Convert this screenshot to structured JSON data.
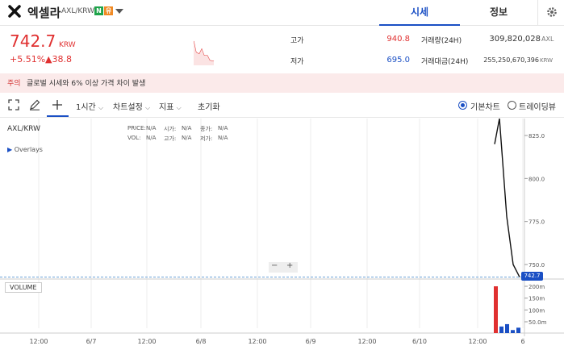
{
  "header": {
    "coin_name": "엑셀라",
    "pair": "AXL/KRW",
    "badge_n": "N",
    "badge_w": "유",
    "tabs": [
      "시세",
      "정보"
    ]
  },
  "price": {
    "value": "742.7",
    "unit": "KRW",
    "change_pct": "+5.51%",
    "change_amt": "▲38.8"
  },
  "stats": {
    "high_label": "고가",
    "high_value": "940.8",
    "low_label": "저가",
    "low_value": "695.0",
    "volume_label": "거래량(24H)",
    "volume_value": "309,820,028",
    "volume_unit": "AXL",
    "turnover_label": "거래대금(24H)",
    "turnover_value": "255,250,670,396",
    "turnover_unit": "KRW"
  },
  "notice": {
    "tag": "주의",
    "text": "글로벌 시세와 6% 이상 가격 차이 발생"
  },
  "toolbar": {
    "interval": "1시간",
    "chart_settings": "차트설정",
    "indicators": "지표",
    "reset": "초기화",
    "basic_chart": "기본차트",
    "trading_view": "트레이딩뷰"
  },
  "chart": {
    "symbol": "AXL/KRW",
    "overlays": "Overlays",
    "ohlc": {
      "price_label": "PRICE:",
      "price": "N/A",
      "open_label": "시가:",
      "open": "N/A",
      "close_label": "종가:",
      "close": "N/A",
      "vol_label": "VOL:",
      "vol": "N/A",
      "high_label": "고가:",
      "high": "N/A",
      "low_label": "저가:",
      "low": "N/A"
    },
    "volume_label": "VOLUME",
    "zoom_minus": "−",
    "zoom_plus": "+",
    "current_price_tag": "742.7",
    "y_ticks": [
      "825.0",
      "800.0",
      "775.0",
      "750.0"
    ],
    "vol_ticks": [
      "200m",
      "150m",
      "100m",
      "50.0m"
    ],
    "x_ticks": [
      "12:00",
      "6/7",
      "12:00",
      "6/8",
      "12:00",
      "6/9",
      "12:00",
      "6/10",
      "12:00",
      "6"
    ],
    "line_color": "#111111",
    "up_color": "#e03030",
    "down_color": "#1a4fc4"
  },
  "chart_data": {
    "type": "line",
    "ylabel": "",
    "ylim": [
      740,
      835
    ],
    "price_series": [
      {
        "x": "last-4",
        "y": 820
      },
      {
        "x": "last-3",
        "y": 838
      },
      {
        "x": "last-2",
        "y": 778
      },
      {
        "x": "last-1",
        "y": 750
      },
      {
        "x": "last",
        "y": 742.7
      }
    ],
    "volume_series": [
      {
        "x": "last-4",
        "y": 200,
        "dir": "up"
      },
      {
        "x": "last-3",
        "y": 30,
        "dir": "down"
      },
      {
        "x": "last-2",
        "y": 40,
        "dir": "down"
      },
      {
        "x": "last-1",
        "y": 15,
        "dir": "down"
      },
      {
        "x": "last",
        "y": 25,
        "dir": "down"
      }
    ]
  }
}
